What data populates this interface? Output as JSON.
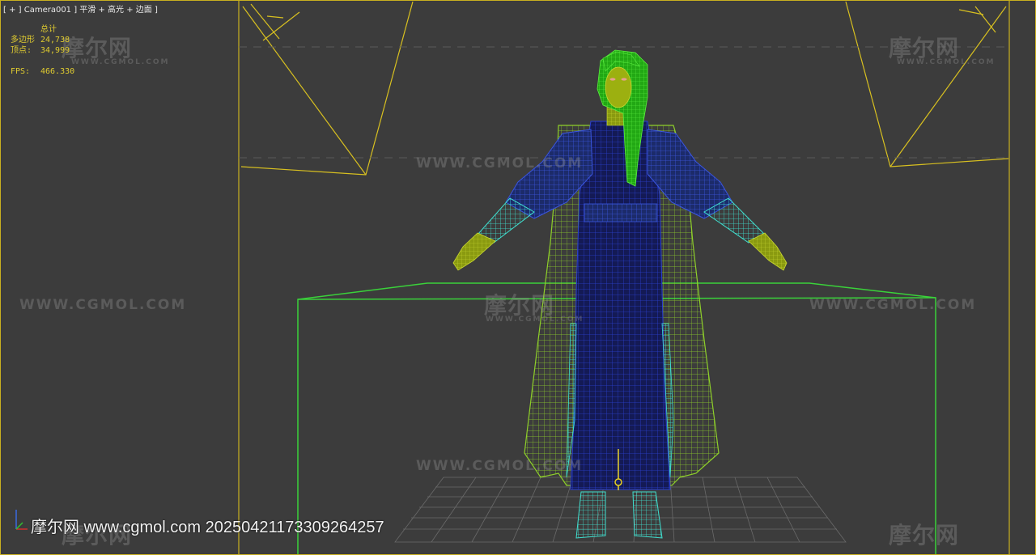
{
  "viewport": {
    "label": "[ + ] Camera001 ] 平滑 + 高光 + 边面 ]"
  },
  "stats": {
    "header": "总计",
    "polygons_label": "多边形",
    "polygons_value": "24,738",
    "vertices_label": "顶点:",
    "vertices_value": "34,999",
    "fps_label": "FPS:",
    "fps_value": "466.330"
  },
  "watermarks": {
    "url": "WWW.CGMOL.COM",
    "brand": "摩尔网",
    "brand_sub": "WWW.CGMOL.COM"
  },
  "footer": {
    "text": "摩尔网 www.cgmol.com 20250421173309264257"
  },
  "colors": {
    "viewport_border": "#c8b020",
    "light_frustum": "#d8c020",
    "bounding_box": "#3ad23a",
    "coat": "#8ecf2a",
    "robe": "#2a3fd0",
    "skin": "#b0c010",
    "hair": "#36d41a",
    "feet": "#40e0d0",
    "grid": "#6a6a6a"
  },
  "icons": {
    "axis": "axis-gizmo-icon"
  }
}
